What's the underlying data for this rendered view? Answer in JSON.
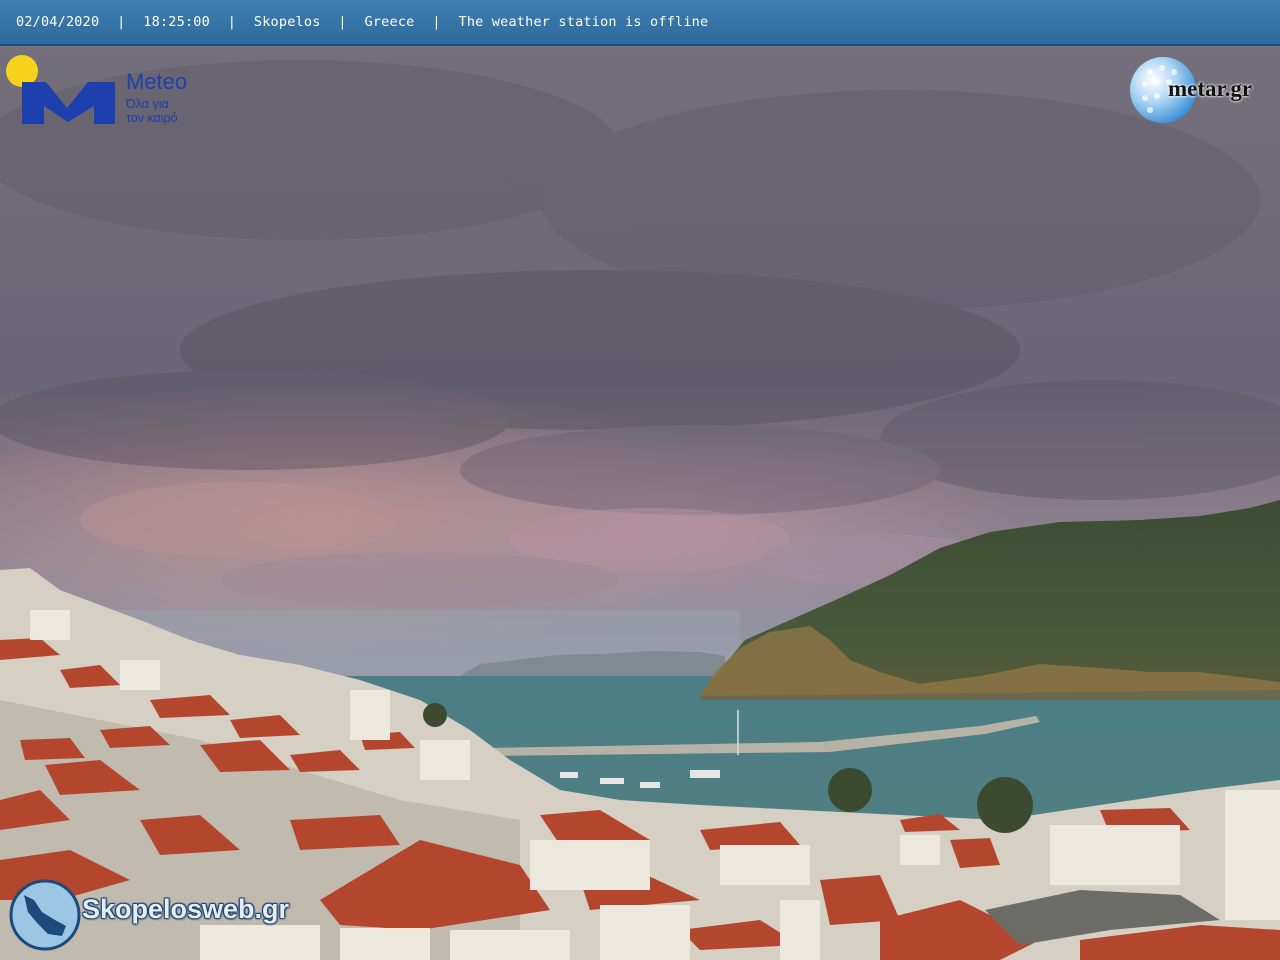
{
  "header": {
    "date": "02/04/2020",
    "time": "18:25:00",
    "location": "Skopelos",
    "country": "Greece",
    "status": "The weather station is offline",
    "separator": "|"
  },
  "meteo_logo": {
    "brand": "Meteo",
    "tagline_line1": "Όλα για",
    "tagline_line2": "τον καιρό",
    "icon": "meteo-m-sun-logo"
  },
  "metar_logo": {
    "text": "metar.gr",
    "icon": "golf-ball-globe-logo"
  },
  "skopelos_logo": {
    "text": "Skopelosweb.gr",
    "icon": "island-map-logo"
  },
  "colors": {
    "header_bar": "#3574a6",
    "meteo_blue": "#1e3fae",
    "sun_yellow": "#f6d21c",
    "roof_red": "#b4462e",
    "sea": "#4f8489"
  }
}
